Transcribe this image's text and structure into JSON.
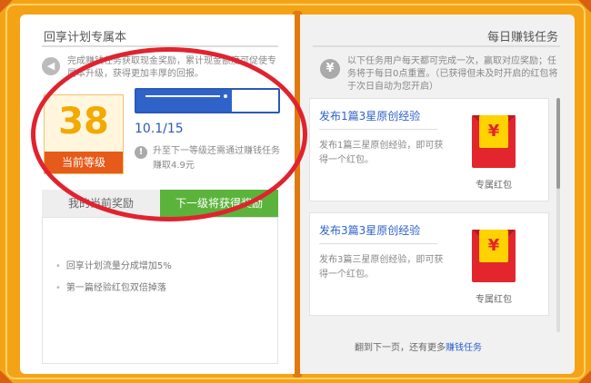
{
  "left": {
    "title": "回享计划专属本",
    "intro": "完成赚钱任务获取现金奖励，累计现金额度可促使专属本升级，获得更加丰厚的回报。",
    "level": {
      "number": "38",
      "label": "当前等级"
    },
    "progress": {
      "text": "10.1/15",
      "fraction": 0.67
    },
    "upgrade_hint": "升至下一等级还需通过赚钱任务赚取4.9元",
    "tabs": {
      "current": "我的当前奖励",
      "next": "下一级将获得奖励"
    },
    "rewards": [
      "回享计划流量分成增加5%",
      "第一篇经验红包双倍掉落"
    ]
  },
  "right": {
    "title": "每日赚钱任务",
    "intro": "以下任务用户每天都可完成一次，赢取对应奖励；任务将于每日0点重置。（已获得但未及时开启的红包将于次日自动为您开启）",
    "tasks": [
      {
        "title": "发布1篇3星原创经验",
        "desc": "发布1篇三星原创经验，即可获得一个红包。",
        "reward": "专属红包"
      },
      {
        "title": "发布3篇3星原创经验",
        "desc": "发布3篇三星原创经验，即可获得一个红包。",
        "reward": "专属红包"
      }
    ],
    "pager": {
      "prefix": "翻到下一页，还有更多",
      "link": "赚钱任务"
    }
  },
  "icons": {
    "speaker": "speaker-icon",
    "yen": "yen-icon",
    "info": "info-icon"
  },
  "colors": {
    "accent_blue": "#2f63c9",
    "level_orange": "#e65a1a",
    "tab_green": "#5bb33b",
    "frame": "#f5a316",
    "annotation_red": "#e0232f"
  }
}
